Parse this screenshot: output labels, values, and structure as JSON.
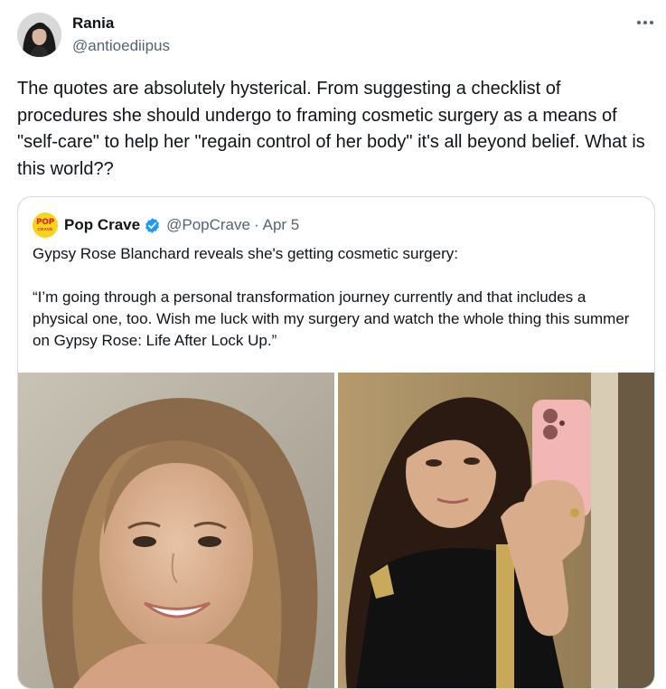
{
  "author": {
    "name": "Rania",
    "handle": "@antioediipus"
  },
  "tweet": {
    "text": "The quotes are absolutely hysterical. From suggesting a checklist of procedures she should undergo to framing cosmetic surgery as a means of \"self-care\" to help her \"regain control of her body\" it's all beyond belief. What is this world??"
  },
  "quoted": {
    "logo_line1": "POP",
    "logo_line2": "CRAVE",
    "name": "Pop Crave",
    "handle": "@PopCrave",
    "separator": "·",
    "date": "Apr 5",
    "text_line1": "Gypsy Rose Blanchard reveals she's getting cosmetic surgery:",
    "text_line2": "“I’m going through a personal transformation journey currently and that includes a physical one, too. Wish me luck with my surgery and watch the whole thing this summer on Gypsy Rose: Life After Lock Up.”"
  },
  "icons": {
    "more": "more-horizontal-icon",
    "verified": "verified-badge-icon"
  },
  "colors": {
    "verified_blue": "#1d9bf0",
    "secondary_text": "#536471",
    "border": "#cfd9de",
    "logo_yellow": "#f7d31e",
    "logo_red": "#d9231d"
  }
}
